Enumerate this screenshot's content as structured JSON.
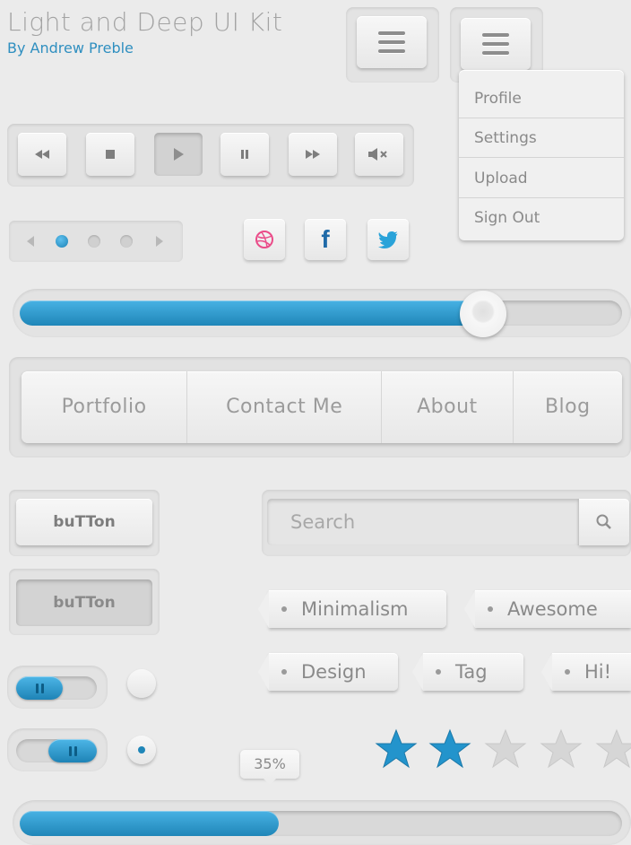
{
  "header": {
    "title": "Light and Deep UI Kit",
    "byline": "By Andrew Preble"
  },
  "dropdown": {
    "items": [
      "Profile",
      "Settings",
      "Upload",
      "Sign Out"
    ]
  },
  "media_controls": [
    "rewind-icon",
    "stop-icon",
    "play-icon",
    "pause-icon",
    "fast-forward-icon",
    "mute-icon"
  ],
  "pager": {
    "active_index": 0,
    "count": 3
  },
  "social": [
    "dribbble-icon",
    "facebook-icon",
    "twitter-icon"
  ],
  "slider": {
    "value_percent": 77
  },
  "nav": {
    "items": [
      "Portfolio",
      "Contact Me",
      "About",
      "Blog"
    ]
  },
  "buttons": {
    "normal_label": "buTTon",
    "pressed_label": "buTTon"
  },
  "search": {
    "placeholder": "Search"
  },
  "tags": [
    "Minimalism",
    "Awesome",
    "Design",
    "Tag",
    "Hi!"
  ],
  "toggles": [
    {
      "on": false
    },
    {
      "on": true
    }
  ],
  "radios": [
    {
      "selected": false
    },
    {
      "selected": true
    }
  ],
  "rating": {
    "value": 2,
    "max": 5
  },
  "progress": {
    "label": "35%",
    "value_percent": 43
  },
  "colors": {
    "accent": "#2a95c9",
    "text": "#8a8a8a",
    "background": "#ebebeb",
    "dribbble": "#ea4c89",
    "facebook": "#1f6aa8"
  }
}
